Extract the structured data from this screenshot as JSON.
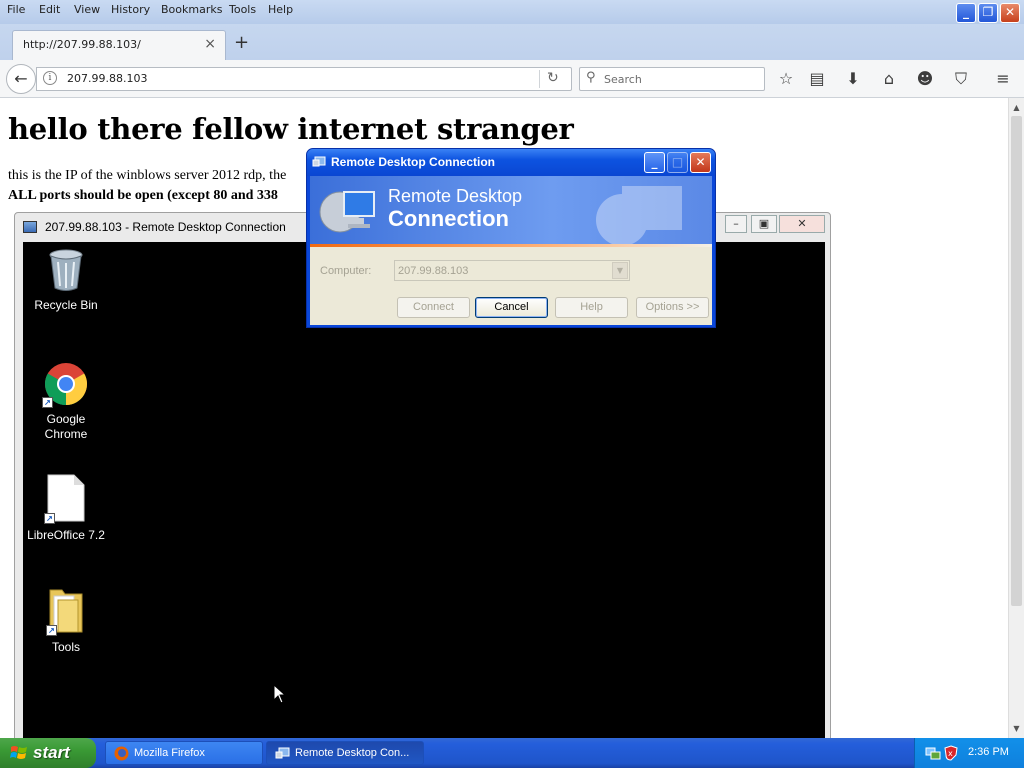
{
  "browser": {
    "menu": [
      "File",
      "Edit",
      "View",
      "History",
      "Bookmarks",
      "Tools",
      "Help"
    ],
    "tab_title": "http://207.99.88.103/",
    "url": "207.99.88.103",
    "search_placeholder": "Search"
  },
  "page": {
    "heading": "hello there fellow internet stranger",
    "line1": "this is the IP of the winblows server 2012 rdp, the",
    "line2": "ALL ports should be open (except 80 and 338"
  },
  "rdp_session": {
    "title": "207.99.88.103 - Remote Desktop Connection",
    "desktop_icons": [
      {
        "label": "Recycle Bin",
        "icon": "recycle-bin-icon"
      },
      {
        "label": "Google Chrome",
        "icon": "chrome-icon"
      },
      {
        "label": "LibreOffice 7.2",
        "icon": "libreoffice-icon"
      },
      {
        "label": "Tools",
        "icon": "folder-icon"
      }
    ]
  },
  "rdc_dialog": {
    "title": "Remote Desktop Connection",
    "banner_line1": "Remote Desktop",
    "banner_line2": "Connection",
    "computer_label": "Computer:",
    "computer_value": "207.99.88.103",
    "buttons": {
      "connect": "Connect",
      "cancel": "Cancel",
      "help": "Help",
      "options": "Options >>"
    }
  },
  "taskbar": {
    "start": "start",
    "tasks": [
      "Mozilla Firefox",
      "Remote Desktop Con..."
    ],
    "clock": "2:36 PM"
  },
  "colors": {
    "xp_taskbar": "#245edb",
    "start_green": "#3a9a35",
    "dialog_face": "#ece9d8"
  }
}
